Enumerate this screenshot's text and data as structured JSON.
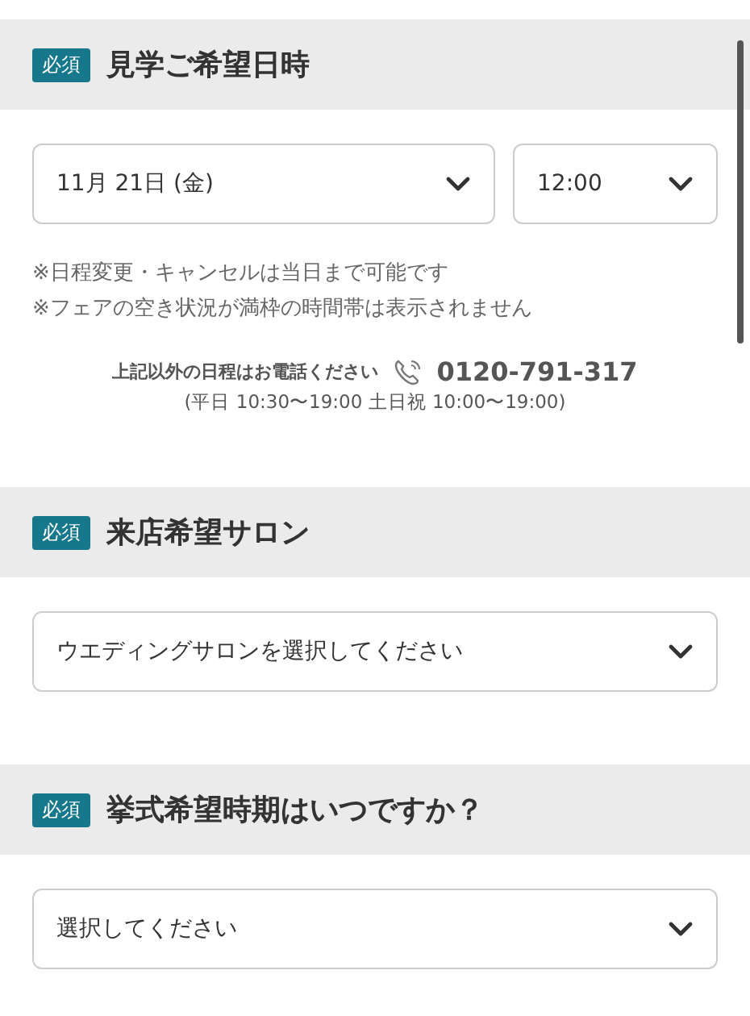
{
  "sections": [
    {
      "badge": "必須",
      "title": "見学ご希望日時",
      "kind": "datetime",
      "selects": [
        {
          "value": "11月 21日 (金)",
          "wide": true
        },
        {
          "value": "12:00",
          "wide": false
        }
      ],
      "notes": [
        "※日程変更・キャンセルは当日まで可能です",
        "※フェアの空き状況が満枠の時間帯は表示されません"
      ],
      "phone": {
        "label": "上記以外の日程はお電話ください",
        "number": "0120-791-317",
        "hours": "(平日 10:30〜19:00 土日祝 10:00〜19:00)"
      }
    },
    {
      "badge": "必須",
      "title": "来店希望サロン",
      "kind": "select",
      "selects": [
        {
          "value": "ウエディングサロンを選択してください",
          "wide": true
        }
      ]
    },
    {
      "badge": "必須",
      "title": "挙式希望時期はいつですか？",
      "kind": "select",
      "selects": [
        {
          "value": "選択してください",
          "wide": true
        }
      ]
    }
  ]
}
